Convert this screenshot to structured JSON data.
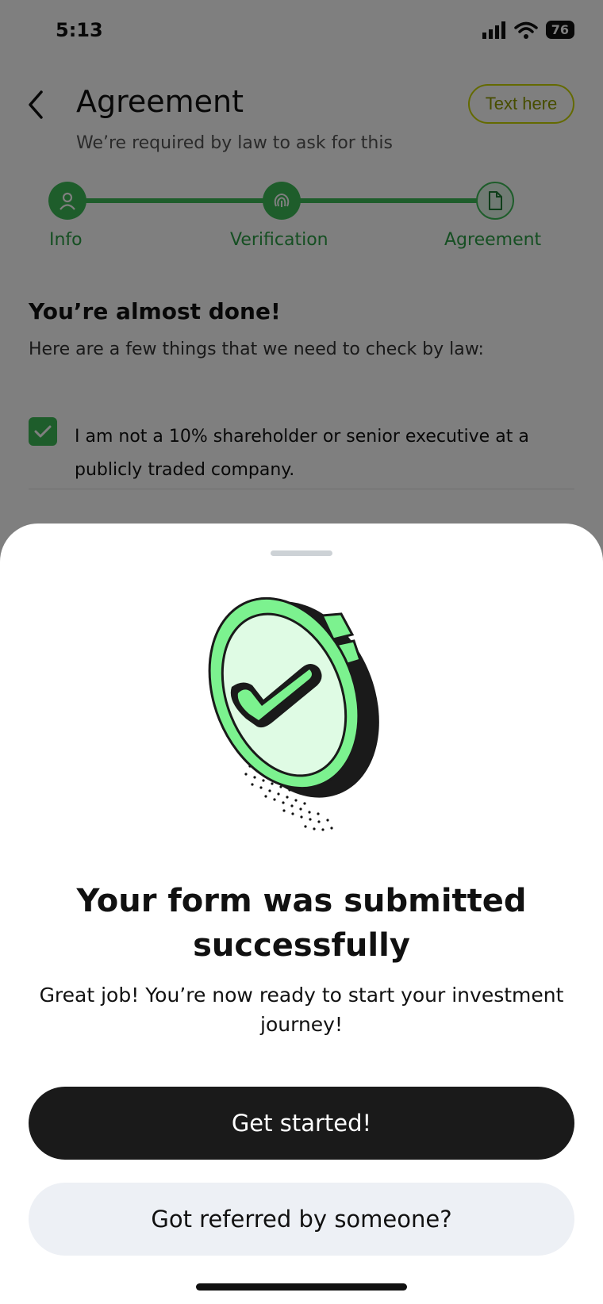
{
  "status_bar": {
    "time": "5:13",
    "battery": "76"
  },
  "header": {
    "title": "Agreement",
    "subtitle": "We’re required by law to ask for this",
    "pill_label": "Text here"
  },
  "stepper": {
    "steps": [
      {
        "label": "Info",
        "icon": "user-icon",
        "state": "done"
      },
      {
        "label": "Verification",
        "icon": "fingerprint-icon",
        "state": "done"
      },
      {
        "label": "Agreement",
        "icon": "document-icon",
        "state": "current"
      }
    ]
  },
  "form": {
    "heading": "You’re almost done!",
    "intro": "Here are a few things that we need to check by law:",
    "checks": [
      {
        "text": "I am not a 10% shareholder or senior executive at a publicly traded company.",
        "checked": true
      }
    ]
  },
  "sheet": {
    "title": "Your form was submitted successfully",
    "body": "Great job! You’re now ready to start your investment journey!",
    "primary_button": "Get started!",
    "secondary_button": "Got referred by someone?"
  },
  "colors": {
    "accent_green": "#3dbb57",
    "coin_green": "#7cf28f",
    "primary_dark": "#1a1a1a",
    "secondary_bg": "#edf0f5",
    "pill_yellow": "#c8d400"
  }
}
